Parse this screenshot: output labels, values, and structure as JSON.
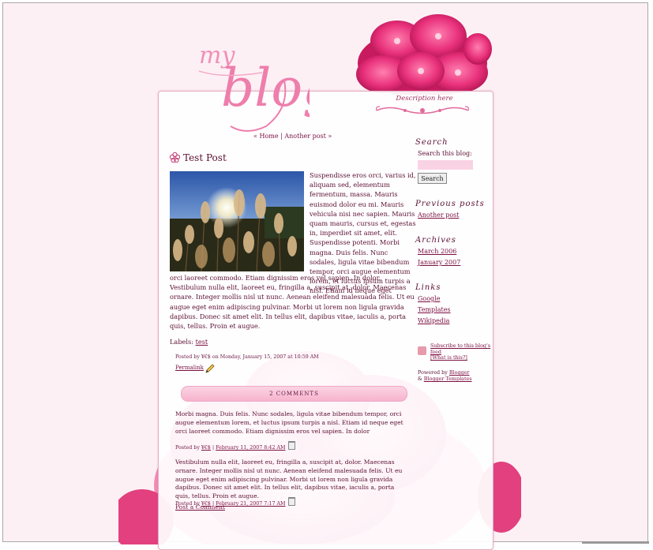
{
  "header": {
    "logo_alt": "my blog",
    "description": "Description here"
  },
  "nav": {
    "prefix": "«",
    "home": "Home",
    "separator": "|",
    "another_post": "Another post",
    "suffix": "»"
  },
  "post": {
    "title": "Test Post",
    "image_icon": "dandelion-photo",
    "body_right": "Suspendisse eros orci, varius id, aliquam sed, elementum fermentum, massa. Mauris euismod dolor eu mi. Mauris vehicula nisi nec sapien. Mauris quam mauris, cursus et, egestas in, imperdiet sit amet, elit. Suspendisse potenti. Morbi magna. Duis felis. Nunc sodales, ligula vitae bibendum tempor, orci augue elementum lorem, et luctus ipsum turpis a nisl. Etiam id neque eget",
    "body_full": "orci laoreet commodo. Etiam dignissim eros vel sapien. In dolor. Vestibulum nulla elit, laoreet eu, fringilla a, suscipit at, dolor. Maecenas ornare. Integer mollis nisl ut nunc. Aenean eleifend malesuada felis. Ut eu augue eget enim adipiscing pulvinar. Morbi ut lorem non ligula gravida dapibus. Donec sit amet elit. In tellus elit, dapibus vitae, iaculis a, porta quis, tellus. Proin et augue.",
    "labels_prefix": "Labels:",
    "label": "test",
    "meta": "Posted by ¥€$ on Monday, January 15, 2007 at 10:59 AM",
    "permalink": "Permalink"
  },
  "comments": {
    "bar_label": "2 COMMENTS",
    "items": [
      {
        "text": "Morbi magna. Duis felis. Nunc sodales, ligula vitae bibendum tempor, orci augue elementum lorem, et luctus ipsum turpis a nisl. Etiam id neque eget orci laoreet commodo. Etiam dignissim eros vel sapien. In dolor",
        "posted_by": "Posted by",
        "author": "¥€$",
        "sep": "|",
        "date": "February 11, 2007 8:42 AM"
      },
      {
        "text": "Vestibulum nulla elit, laoreet eu, fringilla a, suscipit at, dolor. Maecenas ornare. Integer mollis nisl ut nunc. Aenean eleifend malesuada felis. Ut eu augue eget enim adipiscing pulvinar. Morbi ut lorem non ligula gravida dapibus. Donec sit amet elit. In tellus elit, dapibus vitae, iaculis a, porta quis, tellus. Proin et augue.",
        "posted_by": "Posted by",
        "author": "¥€$",
        "sep": "|",
        "date": "February 21, 2007 7:17 AM"
      }
    ],
    "post_a_comment": "Post a Comment"
  },
  "sidebar": {
    "search_heading": "Search",
    "search_label": "Search this blog:",
    "search_value": "",
    "search_button": "Search",
    "previous_heading": "Previous posts",
    "previous_items": [
      "Another post"
    ],
    "archives_heading": "Archives",
    "archive_items": [
      "March 2006",
      "January 2007"
    ],
    "links_heading": "Links",
    "link_items": [
      "Google",
      "Templates",
      "Wikipedia"
    ],
    "subscribe_text": "Subscribe to this blog's feed",
    "what_is_this": "[What is this?]",
    "powered_by": "Powered by",
    "blogger": "Blogger",
    "amp": "&",
    "blogger_templates": "Blogger Templates"
  },
  "colors": {
    "background": "#fdf0f4",
    "text": "#5a1030",
    "accent": "#e0609a",
    "link": "#7a1040"
  }
}
